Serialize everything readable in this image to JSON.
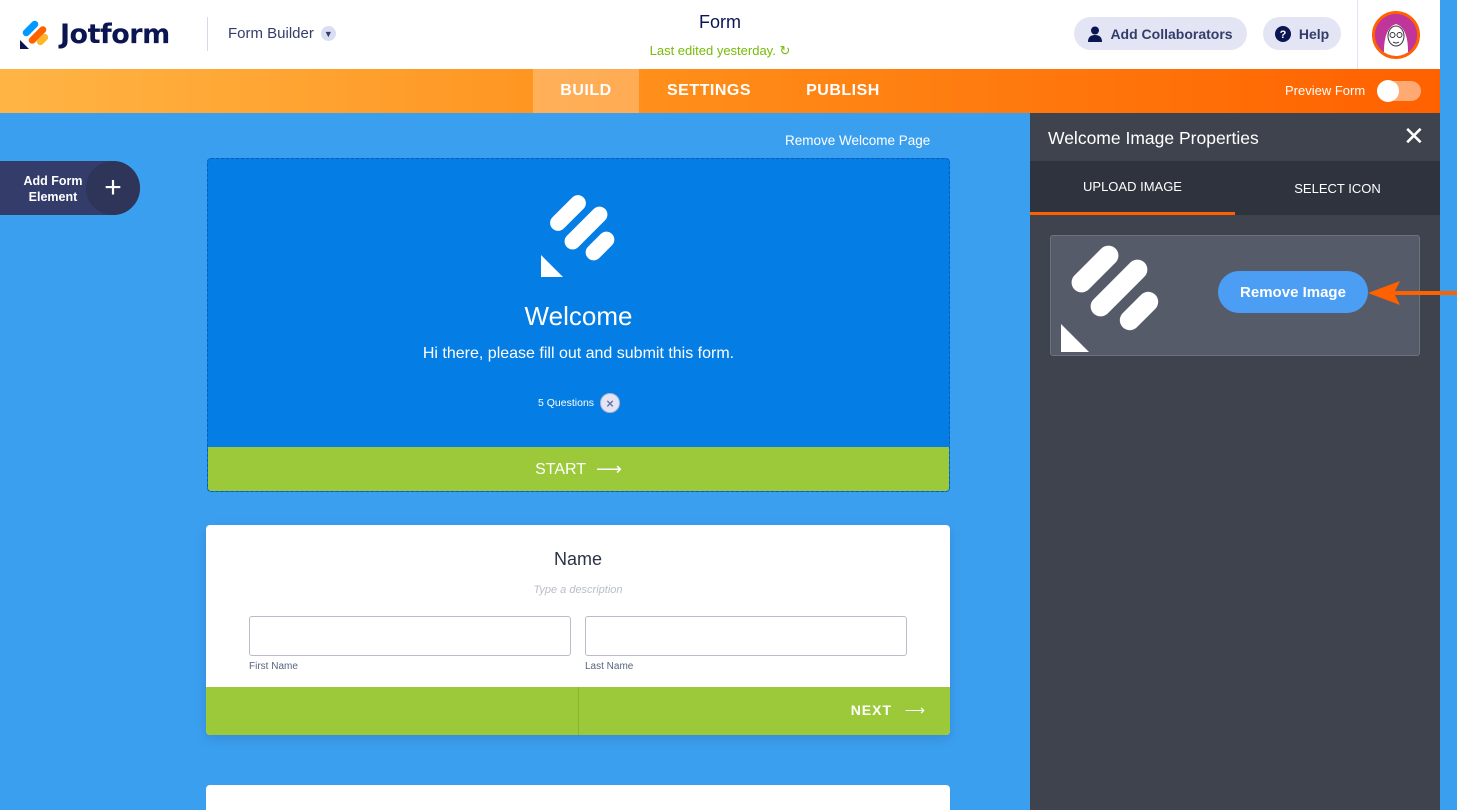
{
  "header": {
    "logo_text": "Jotform",
    "builder_label": "Form Builder",
    "form_title": "Form",
    "last_edited": "Last edited yesterday.",
    "add_collaborators": "Add Collaborators",
    "help": "Help"
  },
  "nav": {
    "tabs": [
      {
        "label": "BUILD",
        "active": true
      },
      {
        "label": "SETTINGS",
        "active": false
      },
      {
        "label": "PUBLISH",
        "active": false
      }
    ],
    "preview_label": "Preview Form",
    "preview_enabled": false
  },
  "canvas": {
    "remove_welcome": "Remove Welcome Page",
    "add_element_label": "Add Form Element",
    "welcome": {
      "title": "Welcome",
      "text": "Hi there, please fill out and submit this form.",
      "questions": "5 Questions",
      "start": "START"
    },
    "name_card": {
      "title": "Name",
      "description_placeholder": "Type a description",
      "first_label": "First Name",
      "last_label": "Last Name",
      "next": "NEXT"
    }
  },
  "panel": {
    "title": "Welcome Image Properties",
    "tabs": [
      "UPLOAD IMAGE",
      "SELECT ICON"
    ],
    "active_tab": "UPLOAD IMAGE",
    "remove_image": "Remove Image"
  },
  "colors": {
    "accent_orange": "#ff6100",
    "welcome_blue": "#047de4",
    "green": "#9cc93a",
    "panel_bg": "#3e434e",
    "canvas_bg": "#3b9ff0"
  }
}
